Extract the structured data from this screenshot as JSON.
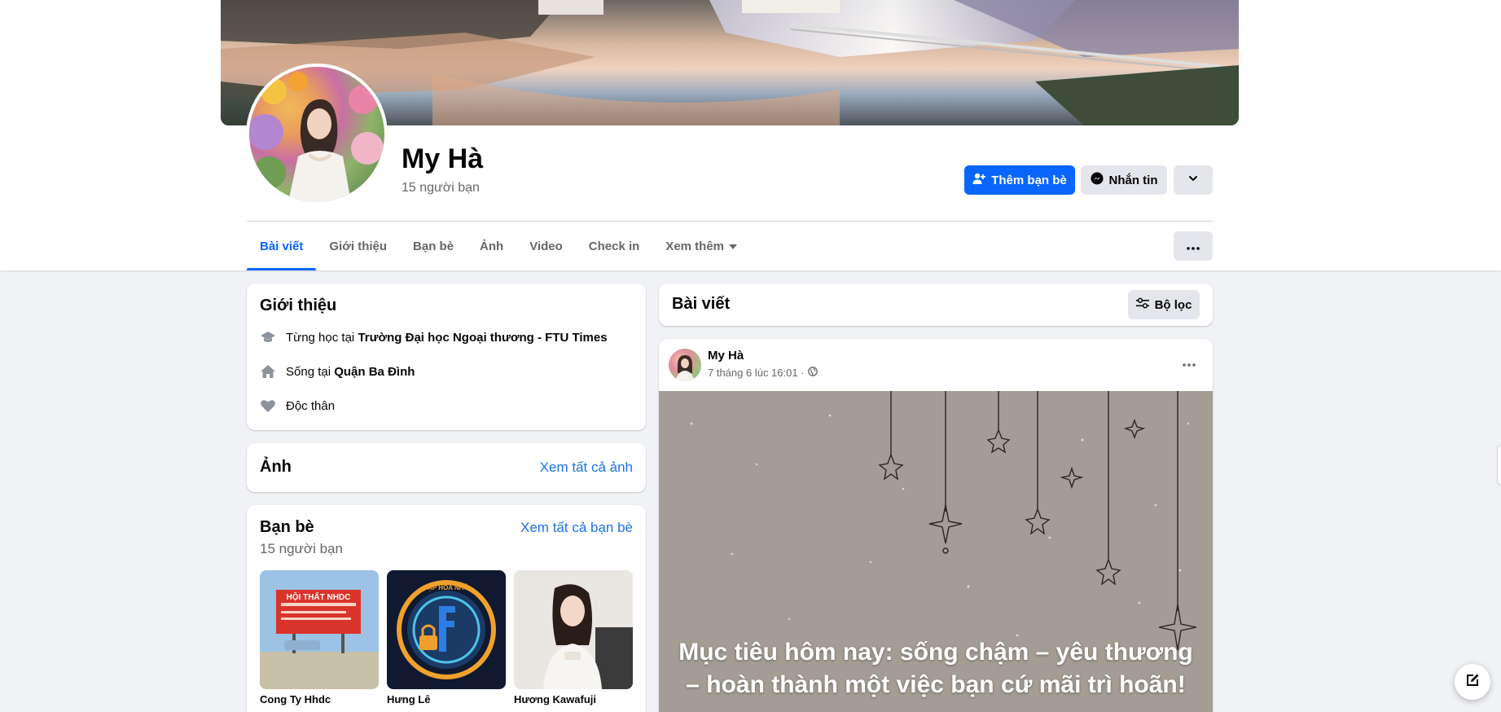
{
  "profile": {
    "name": "My Hà",
    "friend_count": "15 người bạn"
  },
  "actions": {
    "add_friend": "Thêm bạn bè",
    "message": "Nhắn tin"
  },
  "tabs": [
    {
      "label": "Bài viết",
      "active": true
    },
    {
      "label": "Giới thiệu"
    },
    {
      "label": "Bạn bè"
    },
    {
      "label": "Ảnh"
    },
    {
      "label": "Video"
    },
    {
      "label": "Check in"
    },
    {
      "label": "Xem thêm"
    }
  ],
  "intro": {
    "title": "Giới thiệu",
    "education_prefix": "Từng học tại",
    "education_value": "Trường Đại học Ngoại thương - FTU Times",
    "lives_prefix": "Sống tại",
    "lives_value": "Quận Ba Đình",
    "relationship": "Độc thân"
  },
  "photos": {
    "title": "Ảnh",
    "see_all": "Xem tất cả ảnh"
  },
  "friends": {
    "title": "Bạn bè",
    "see_all": "Xem tất cả bạn bè",
    "count": "15 người bạn",
    "items": [
      {
        "name": "Cong Ty Hhdc",
        "sign_text": "HỘI THẤT NHDC"
      },
      {
        "name": "Hưng Lê",
        "logo_text": "TẬP HỒA NHỎ"
      },
      {
        "name": "Hương Kawafuji"
      }
    ]
  },
  "posts": {
    "title": "Bài viết",
    "filter": "Bộ lọc"
  },
  "post": {
    "author": "My Hà",
    "time": "7 tháng 6 lúc 16:01 ·",
    "quote": "Mục tiêu hôm nay: sống chậm – yêu thương – hoàn thành một việc bạn cứ mãi trì hoãn!"
  },
  "colors": {
    "primary": "#0866ff",
    "link": "#1a73e8",
    "background": "#f0f2f5",
    "secondary_text": "#65676b",
    "button_gray": "#e4e6eb"
  },
  "icons": [
    "add-friend-icon",
    "messenger-icon",
    "chevron-down-icon",
    "more-dots-icon",
    "graduation-cap-icon",
    "home-icon",
    "heart-icon",
    "filter-icon",
    "globe-icon",
    "compose-icon"
  ]
}
